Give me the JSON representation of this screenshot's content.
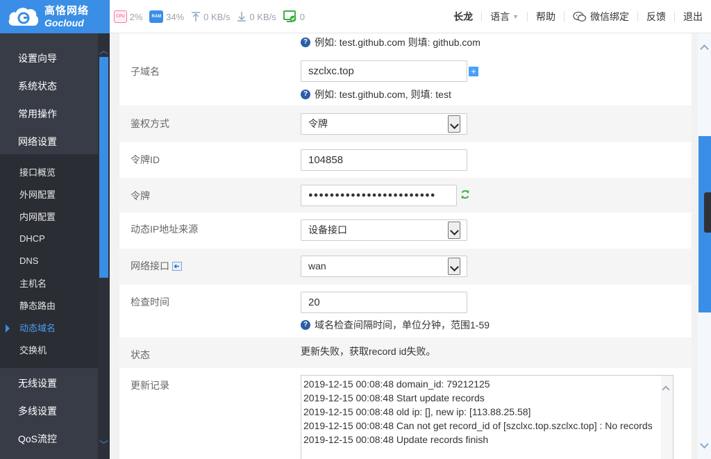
{
  "brand": {
    "name_cn": "高恪网络",
    "name_en": "Gocloud",
    "color": "#3a8ee6"
  },
  "stats": {
    "cpu_chip": "CPU",
    "cpu": "2%",
    "ram_chip": "RAM",
    "ram": "34%",
    "upload": "0 KB/s",
    "download": "0 KB/s",
    "online": "0"
  },
  "topnav": {
    "user": "长龙",
    "language": "语言",
    "help": "帮助",
    "wechat": "微信绑定",
    "feedback": "反馈",
    "logout": "退出"
  },
  "sidebar": {
    "items": [
      "设置向导",
      "系统状态",
      "常用操作",
      "网络设置"
    ],
    "network_sub": [
      "接口概览",
      "外网配置",
      "内网配置",
      "DHCP",
      "DNS",
      "主机名",
      "静态路由",
      "动态域名",
      "交换机"
    ],
    "active_sub": "动态域名",
    "items_after": [
      "无线设置",
      "多线设置",
      "QoS流控"
    ]
  },
  "form": {
    "top_hint": "例如: test.github.com 则填: github.com",
    "subdomain": {
      "label": "子域名",
      "value": "szclxc.top",
      "hint": "例如: test.github.com, 则填: test"
    },
    "auth": {
      "label": "鉴权方式",
      "value": "令牌"
    },
    "token_id": {
      "label": "令牌ID",
      "value": "104858"
    },
    "token": {
      "label": "令牌",
      "value": "●●●●●●●●●●●●●●●●●●●●●●●●"
    },
    "ip_source": {
      "label": "动态IP地址来源",
      "value": "设备接口"
    },
    "interface": {
      "label": "网络接口",
      "value": "wan"
    },
    "check_time": {
      "label": "检查时间",
      "value": "20",
      "hint": "域名检查间隔时间，单位分钟，范围1-59"
    },
    "status": {
      "label": "状态",
      "value": "更新失败，获取record id失败。"
    },
    "log": {
      "label": "更新记录",
      "lines": [
        "2019-12-15 00:08:48 domain_id: 79212125",
        "2019-12-15 00:08:48 Start update records",
        "2019-12-15 00:08:48 old ip: [], new ip: [113.88.25.58]",
        "2019-12-15 00:08:48 Can not get record_id of [szclxc.top.szclxc.top] : No records",
        "2019-12-15 00:08:48 Update records finish"
      ]
    }
  }
}
